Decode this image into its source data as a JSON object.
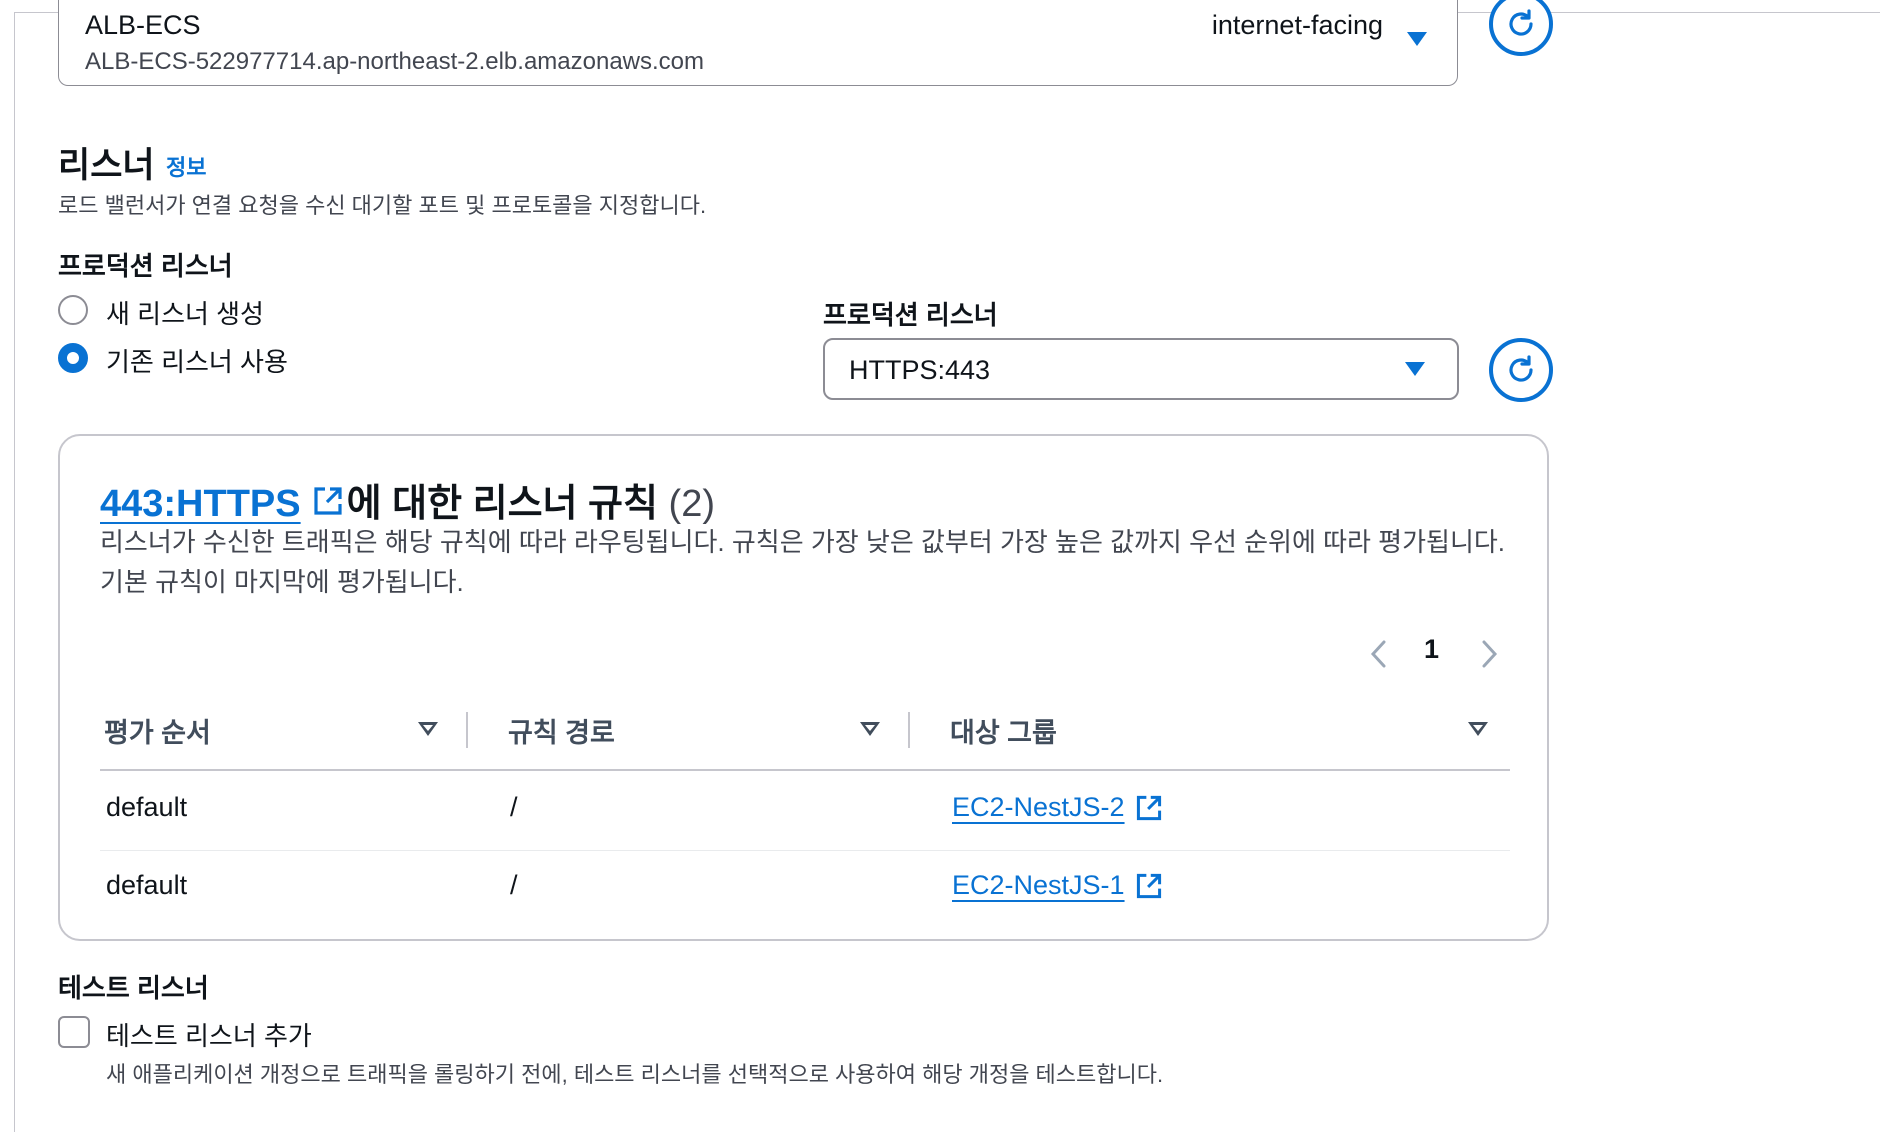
{
  "load_balancer": {
    "name": "ALB-ECS",
    "dns": "ALB-ECS-522977714.ap-northeast-2.elb.amazonaws.com",
    "scheme": "internet-facing"
  },
  "listener_section": {
    "title": "리스너",
    "info_link": "정보",
    "description": "로드 밸런서가 연결 요청을 수신 대기할 포트 및 프로토콜을 지정합니다."
  },
  "production_listener": {
    "heading": "프로덕션 리스너",
    "options": [
      {
        "label": "새 리스너 생성",
        "selected": false
      },
      {
        "label": "기존 리스너 사용",
        "selected": true
      }
    ],
    "select_label": "프로덕션 리스너",
    "select_value": "HTTPS:443"
  },
  "rules_card": {
    "title_link": "443:HTTPS",
    "title_suffix": "에 대한 리스너 규칙",
    "count": "(2)",
    "description": "리스너가 수신한 트래픽은 해당 규칙에 따라 라우팅됩니다. 규칙은 가장 낮은 값부터 가장 높은 값까지 우선 순위에 따라 평가됩니다. 기본 규칙이 마지막에 평가됩니다.",
    "page": "1",
    "columns": [
      "평가 순서",
      "규칙 경로",
      "대상 그룹"
    ],
    "rows": [
      {
        "order": "default",
        "path": "/",
        "target": "EC2-NestJS-2"
      },
      {
        "order": "default",
        "path": "/",
        "target": "EC2-NestJS-1"
      }
    ]
  },
  "test_listener": {
    "heading": "테스트 리스너",
    "checkbox_label": "테스트 리스너 추가",
    "checked": false,
    "description": "새 애플리케이션 개정으로 트래픽을 롤링하기 전에, 테스트 리스너를 선택적으로 사용하여 해당 개정을 테스트합니다."
  },
  "colors": {
    "accent": "#0972d3",
    "text": "#0f141a",
    "muted": "#424650",
    "border": "#8c8c94"
  }
}
